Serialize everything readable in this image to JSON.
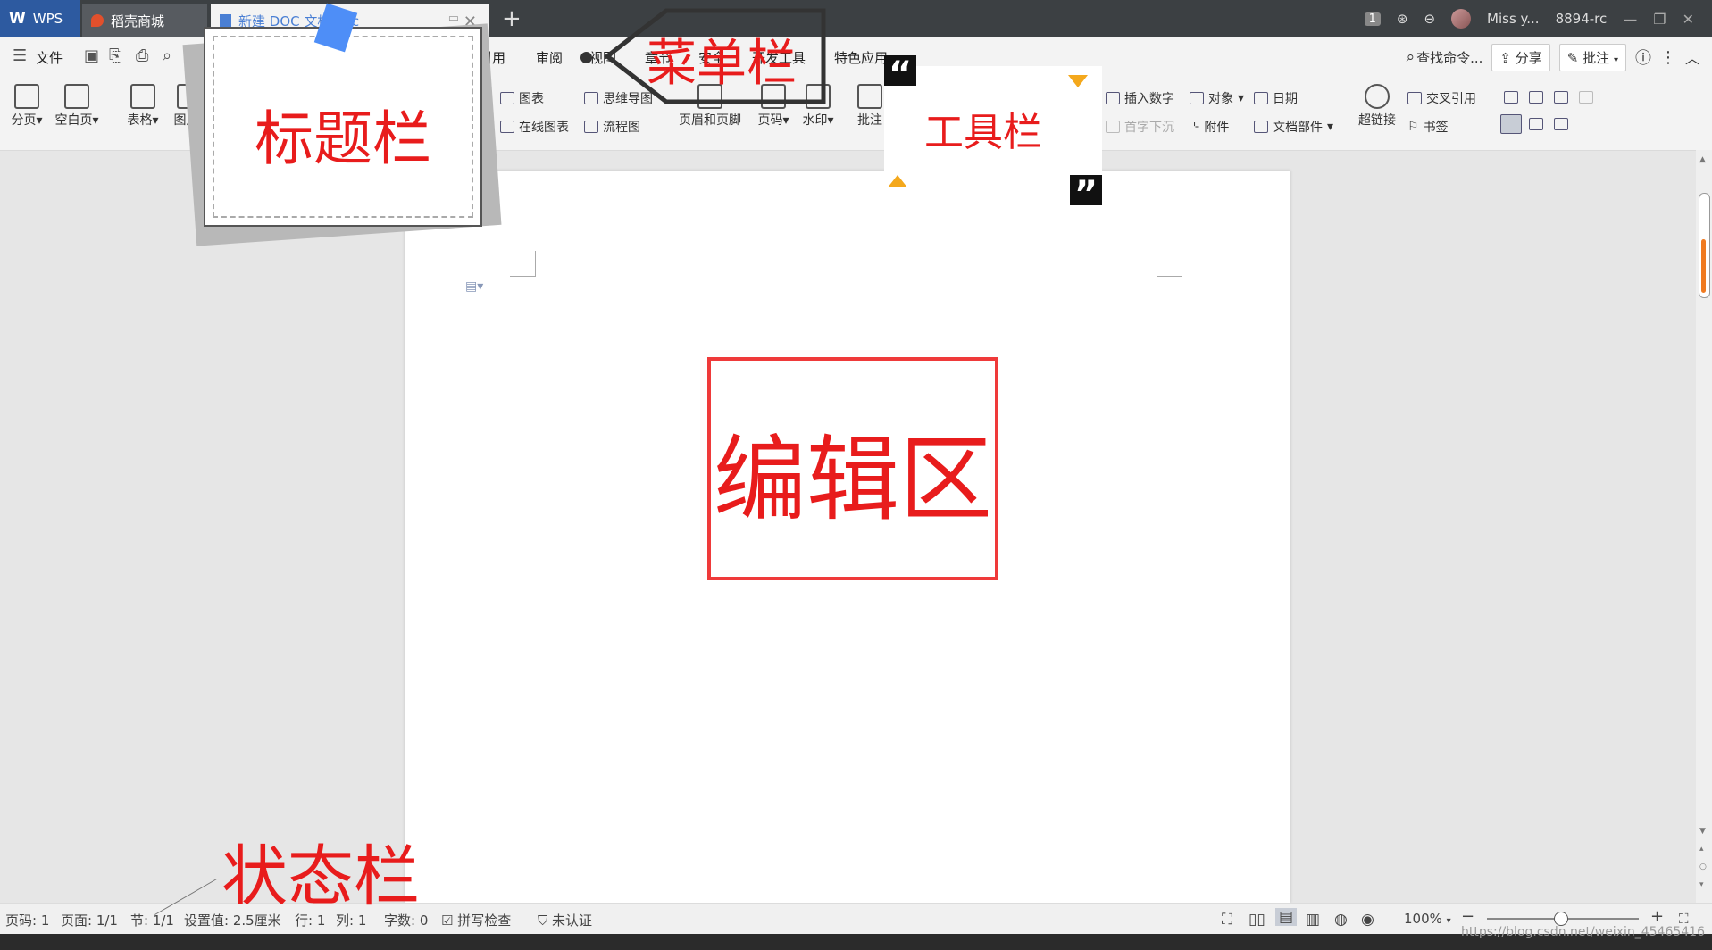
{
  "titlebar": {
    "app_tab": "WPS",
    "store_tab": "稻壳商城",
    "doc_tab": "新建 DOC 文档.doc",
    "new_tab": "+",
    "badge": "1",
    "user": "Miss y...",
    "user_id": "8894-rc"
  },
  "menubar": {
    "file": "文件",
    "items": [
      "引用",
      "审阅",
      "视图",
      "章节",
      "安全",
      "开发工具",
      "特色应用"
    ],
    "search": "查找命令...",
    "share": "分享",
    "review": "批注"
  },
  "toolbar": {
    "page_break": "分页",
    "blank_page": "空白页",
    "table": "表格",
    "picture": "图片",
    "chart": "图表",
    "mindmap": "思维导图",
    "online_chart": "在线图表",
    "flowchart": "流程图",
    "header_footer": "页眉和页脚",
    "page_number": "页码",
    "watermark": "水印",
    "comment": "批注",
    "insert_number": "插入数字",
    "object": "对象",
    "date": "日期",
    "drop_cap": "首字下沉",
    "attachment": "附件",
    "doc_parts": "文档部件",
    "hyperlink": "超链接",
    "cross_ref": "交叉引用",
    "bookmark": "书签"
  },
  "statusbar": {
    "page_no": "页码: 1",
    "pages": "页面: 1/1",
    "section": "节: 1/1",
    "setting": "设置值: 2.5厘米",
    "row": "行: 1",
    "col": "列: 1",
    "words": "字数: 0",
    "spell": "拼写检查",
    "cert": "未认证",
    "zoom": "100%"
  },
  "annotations": {
    "title_bar": "标题栏",
    "menu_bar": "菜单栏",
    "tool_bar": "工具栏",
    "edit_area": "编辑区",
    "status_bar": "状态栏"
  },
  "watermark": "https://blog.csdn.net/weixin_45465416"
}
